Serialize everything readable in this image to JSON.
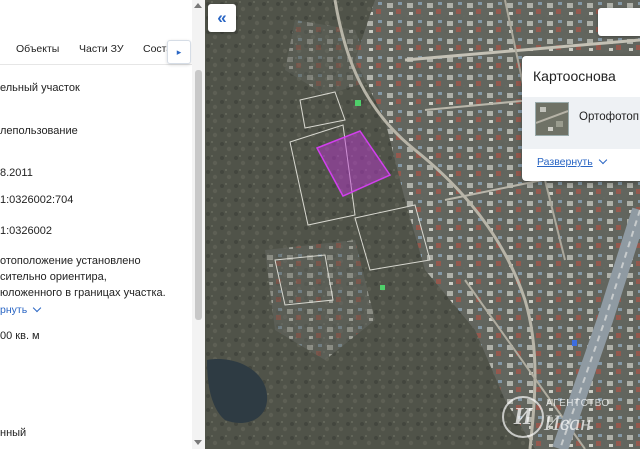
{
  "tabs": [
    {
      "label": "Объекты"
    },
    {
      "label": "Части ЗУ"
    },
    {
      "label": "Соста"
    }
  ],
  "tab_scroll_glyph": "▸",
  "info": {
    "line1": "ельный участок",
    "line2": "лепользование",
    "line3": "8.2011",
    "line4": "1:0326002:704",
    "line5": "1:0326002",
    "line6": "отоположение установлено",
    "line7": "сительно ориентира,",
    "line8": "юложенного в границах участка.",
    "expand": "рнуть",
    "line9": "00 кв. м",
    "line10": "нный"
  },
  "map": {
    "collapse_glyph": "«",
    "basemap": {
      "title": "Картооснова",
      "option_label": "Ортофотоп",
      "expand_link": "Развернуть"
    },
    "watermark": {
      "top": "АГЕНТСТВО",
      "bottom": "Иван",
      "logo_letter": "И"
    },
    "parcel_color": "#c036d8"
  }
}
